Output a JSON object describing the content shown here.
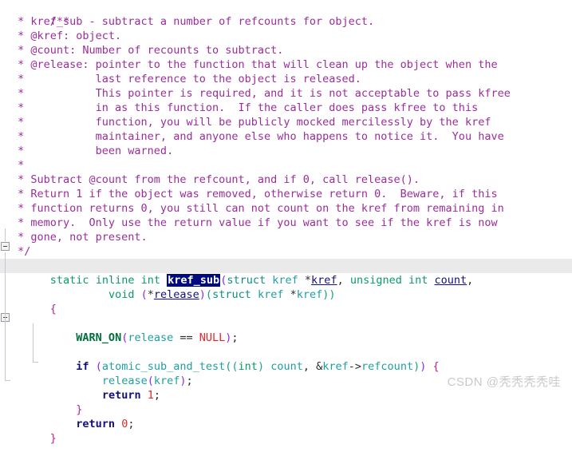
{
  "editor": {
    "language": "C",
    "colors": {
      "background": "#ffffff",
      "comment": "#9b2d9b",
      "keyword": "#0a9a6a",
      "identifier": "#1fa0a0",
      "control": "#13107e",
      "number": "#e8262a",
      "function": "#006f3c",
      "brace": "#b0249b",
      "selection_bg": "#000a80",
      "selection_fg": "#ffffff",
      "current_line_bg": "#eaeaea",
      "guide": "#c9c4d6"
    },
    "selected_token": "kref_sub",
    "fold_marker": "-"
  },
  "comment_block": {
    "open": "/**",
    "lines": [
      " * kref_sub - subtract a number of refcounts for object.",
      " * @kref: object.",
      " * @count: Number of recounts to subtract.",
      " * @release: pointer to the function that will clean up the object when the",
      " *           last reference to the object is released.",
      " *           This pointer is required, and it is not acceptable to pass kfree",
      " *           in as this function.  If the caller does pass kfree to this",
      " *           function, you will be publicly mocked mercilessly by the kref",
      " *           maintainer, and anyone else who happens to notice it.  You have",
      " *           been warned.",
      " *",
      " * Subtract @count from the refcount, and if 0, call release().",
      " * Return 1 if the object was removed, otherwise return 0.  Beware, if this",
      " * function returns 0, you still can not count on the kref from remaining in",
      " * memory.  Only use the return value if you want to see if the kref is now",
      " * gone, not present."
    ],
    "close": " */"
  },
  "code": {
    "signature": {
      "kw_static": "static",
      "kw_inline": "inline",
      "kw_int": "int",
      "name": "kref_sub",
      "open_paren": "(",
      "kw_struct": "struct",
      "type_kref": "kref",
      "star": "*",
      "param_kref": "kref",
      "comma1": ", ",
      "kw_unsigned": "unsigned",
      "kw_int2": "int",
      "param_count": "count",
      "comma2": ","
    },
    "signature_line2": {
      "kw_void": "void",
      "open_paren": "(",
      "star": "*",
      "param_release": "release",
      "close_paren": ")",
      "open_paren2": "(",
      "kw_struct": "struct",
      "type_kref": "kref",
      "star2": "*",
      "param_kref": "kref",
      "close": "))"
    },
    "open_brace": "{",
    "warn_line": {
      "fn": "WARN_ON",
      "open": "(",
      "arg": "release",
      "op": " == ",
      "null": "NULL",
      "close": ")",
      "semi": ";"
    },
    "if_line": {
      "kw_if": "if",
      "open1": " (",
      "fn": "atomic_sub_and_test",
      "open2": "(",
      "cast_open": "(",
      "cast_type": "int",
      "cast_close": ")",
      "arg1": " count",
      "comma": ", ",
      "amp": "&",
      "arg2": "kref",
      "arrow": "->",
      "arg3": "refcount",
      "close2": ")",
      "close1": ")",
      "brace": " {"
    },
    "release_call": {
      "fn": "release",
      "open": "(",
      "arg": "kref",
      "close": ")",
      "semi": ";"
    },
    "return_one": {
      "kw": "return",
      "value": "1",
      "semi": ";"
    },
    "close_if_brace": "}",
    "return_zero": {
      "kw": "return",
      "value": "0",
      "semi": ";"
    },
    "close_fn_brace": "}"
  },
  "watermark": {
    "text": "CSDN @秃秃秃秃哇"
  }
}
